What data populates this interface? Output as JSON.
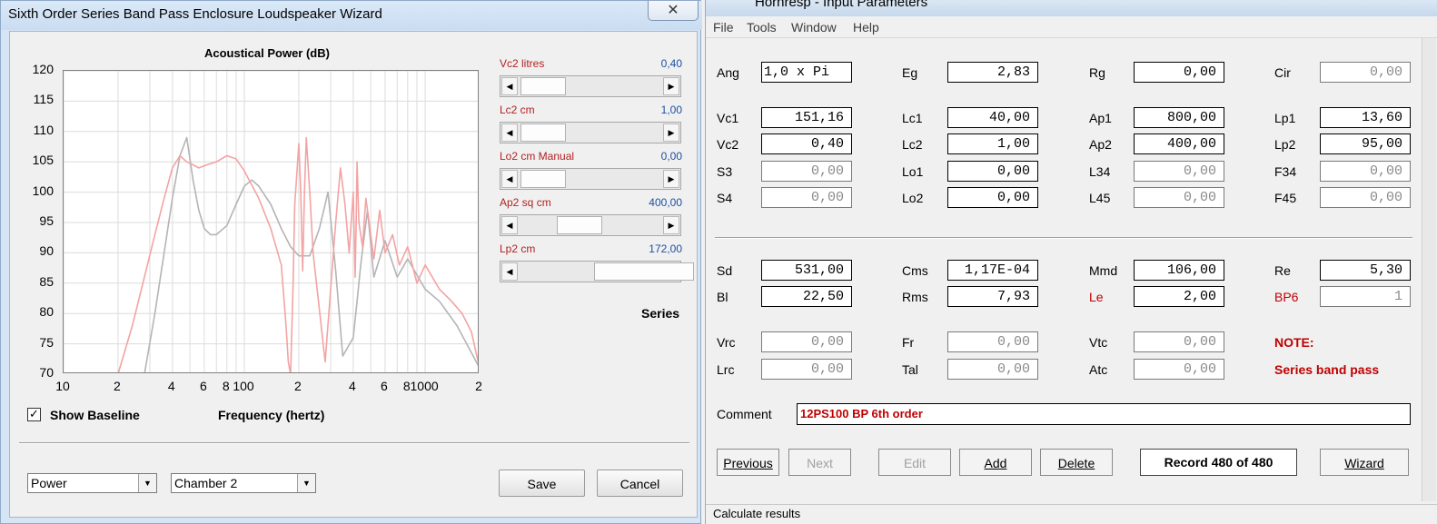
{
  "wizard": {
    "title": "Sixth Order Series Band Pass Enclosure Loudspeaker Wizard",
    "chart_title": "Acoustical Power (dB)",
    "x_axis_label": "Frequency (hertz)",
    "close_glyph": "✕",
    "y_ticks": [
      "120",
      "115",
      "110",
      "105",
      "100",
      "95",
      "90",
      "85",
      "80",
      "75",
      "70"
    ],
    "x_ticks": [
      "10",
      "2",
      "4",
      "6",
      "8",
      "100",
      "2",
      "4",
      "6",
      "8",
      "1000",
      "2"
    ],
    "sliders": [
      {
        "label": "Vc2  litres",
        "value": "0,40",
        "position": 0.02
      },
      {
        "label": "Lc2  cm",
        "value": "1,00",
        "position": 0.02
      },
      {
        "label": "Lo2  cm  Manual",
        "value": "0,00",
        "position": 0.02
      },
      {
        "label": "Ap2  sq cm",
        "value": "400,00",
        "position": 0.36
      },
      {
        "label": "Lp2  cm",
        "value": "172,00",
        "position": 0.7
      }
    ],
    "series_label": "Series",
    "show_baseline": {
      "label": "Show Baseline",
      "checked": true
    },
    "combo_view": "Power",
    "combo_chamber": "Chamber 2",
    "save_label": "Save",
    "cancel_label": "Cancel",
    "colors": {
      "current": "#f3a3a3",
      "baseline": "#b4b4b4"
    }
  },
  "chart_data": {
    "type": "line",
    "title": "Acoustical Power (dB)",
    "xlabel": "Frequency (hertz)",
    "ylabel": "",
    "x_scale": "log",
    "xlim": [
      10,
      2000
    ],
    "ylim": [
      70,
      120
    ],
    "grid": true,
    "series": [
      {
        "color": "#f3a3a3",
        "x": [
          20,
          24,
          28,
          32,
          36,
          40,
          44,
          48,
          52,
          56,
          62,
          70,
          80,
          90,
          100,
          120,
          140,
          160,
          170,
          175,
          180,
          186,
          190,
          200,
          205,
          210,
          215,
          220,
          230,
          240,
          280,
          300,
          320,
          340,
          360,
          380,
          400,
          410,
          415,
          420,
          430,
          450,
          470,
          490,
          520,
          560,
          600,
          660,
          720,
          800,
          900,
          1000,
          1200,
          1400,
          1600,
          1800,
          2000
        ],
        "y": [
          70,
          78,
          86,
          93,
          99,
          104,
          106,
          105,
          104.5,
          104,
          104.5,
          105,
          106,
          105.5,
          103.5,
          99,
          94,
          88,
          78,
          72,
          70,
          85,
          98,
          108,
          100,
          87,
          100,
          109,
          100,
          90,
          72,
          84,
          95,
          104,
          98,
          90,
          100,
          86,
          95,
          105,
          95,
          91,
          99,
          95,
          89,
          97,
          90,
          93,
          88,
          91,
          85,
          88,
          84,
          82,
          80,
          77,
          71
        ]
      },
      {
        "color": "#b4b4b4",
        "x": [
          28,
          32,
          36,
          40,
          44,
          48,
          52,
          56,
          60,
          65,
          70,
          80,
          90,
          100,
          110,
          120,
          140,
          160,
          180,
          200,
          230,
          260,
          290,
          320,
          350,
          400,
          420,
          440,
          480,
          520,
          600,
          700,
          800,
          1000,
          1200,
          1500,
          2000
        ],
        "y": [
          70,
          80,
          90,
          99,
          106,
          109,
          102,
          97,
          94,
          93,
          93,
          94.5,
          98,
          101,
          102,
          101,
          98,
          94,
          91,
          89.5,
          89.5,
          94,
          100,
          87,
          73,
          76,
          82,
          88,
          97,
          86,
          92,
          86,
          89,
          84,
          82,
          78,
          71
        ]
      }
    ]
  },
  "hornresp": {
    "title": "Hornresp - Input Parameters",
    "menu": [
      "File",
      "Tools",
      "Window",
      "Help"
    ],
    "rows": [
      [
        {
          "label": "Ang",
          "value": "1,0 x Pi",
          "dis": false,
          "left": true
        },
        {
          "label": "Eg",
          "value": "2,83",
          "dis": false
        },
        {
          "label": "Rg",
          "value": "0,00",
          "dis": false
        },
        {
          "label": "Cir",
          "value": "0,00",
          "dis": true
        }
      ],
      [
        {
          "label": "Vc1",
          "value": "151,16",
          "dis": false
        },
        {
          "label": "Lc1",
          "value": "40,00",
          "dis": false
        },
        {
          "label": "Ap1",
          "value": "800,00",
          "dis": false
        },
        {
          "label": "Lp1",
          "value": "13,60",
          "dis": false
        }
      ],
      [
        {
          "label": "Vc2",
          "value": "0,40",
          "dis": false
        },
        {
          "label": "Lc2",
          "value": "1,00",
          "dis": false
        },
        {
          "label": "Ap2",
          "value": "400,00",
          "dis": false
        },
        {
          "label": "Lp2",
          "value": "95,00",
          "dis": false
        }
      ],
      [
        {
          "label": "S3",
          "value": "0,00",
          "dis": true
        },
        {
          "label": "Lo1",
          "value": "0,00",
          "dis": false
        },
        {
          "label": "L34",
          "value": "0,00",
          "dis": true
        },
        {
          "label": "F34",
          "value": "0,00",
          "dis": true
        }
      ],
      [
        {
          "label": "S4",
          "value": "0,00",
          "dis": true
        },
        {
          "label": "Lo2",
          "value": "0,00",
          "dis": false
        },
        {
          "label": "L45",
          "value": "0,00",
          "dis": true
        },
        {
          "label": "F45",
          "value": "0,00",
          "dis": true
        }
      ],
      [
        {
          "label": "Sd",
          "value": "531,00",
          "dis": false
        },
        {
          "label": "Cms",
          "value": "1,17E-04",
          "dis": false
        },
        {
          "label": "Mmd",
          "value": "106,00",
          "dis": false
        },
        {
          "label": "Re",
          "value": "5,30",
          "dis": false
        }
      ],
      [
        {
          "label": "Bl",
          "value": "22,50",
          "dis": false
        },
        {
          "label": "Rms",
          "value": "7,93",
          "dis": false
        },
        {
          "label": "Le",
          "value": "2,00",
          "dis": false,
          "red": true
        },
        {
          "label": "BP6",
          "value": "1",
          "dis": true,
          "red": true
        }
      ],
      [
        {
          "label": "Vrc",
          "value": "0,00",
          "dis": true
        },
        {
          "label": "Fr",
          "value": "0,00",
          "dis": true
        },
        {
          "label": "Vtc",
          "value": "0,00",
          "dis": true
        }
      ],
      [
        {
          "label": "Lrc",
          "value": "0,00",
          "dis": true
        },
        {
          "label": "Tal",
          "value": "0,00",
          "dis": true
        },
        {
          "label": "Atc",
          "value": "0,00",
          "dis": true
        }
      ]
    ],
    "note_label": "NOTE:",
    "note_text": "Series band pass",
    "comment_label": "Comment",
    "comment_value": "12PS100 BP 6th order",
    "buttons": {
      "previous": "Previous",
      "next": "Next",
      "edit": "Edit",
      "add": "Add",
      "delete": "Delete",
      "wizard": "Wizard"
    },
    "record": "Record 480 of 480",
    "status": "Calculate results"
  }
}
